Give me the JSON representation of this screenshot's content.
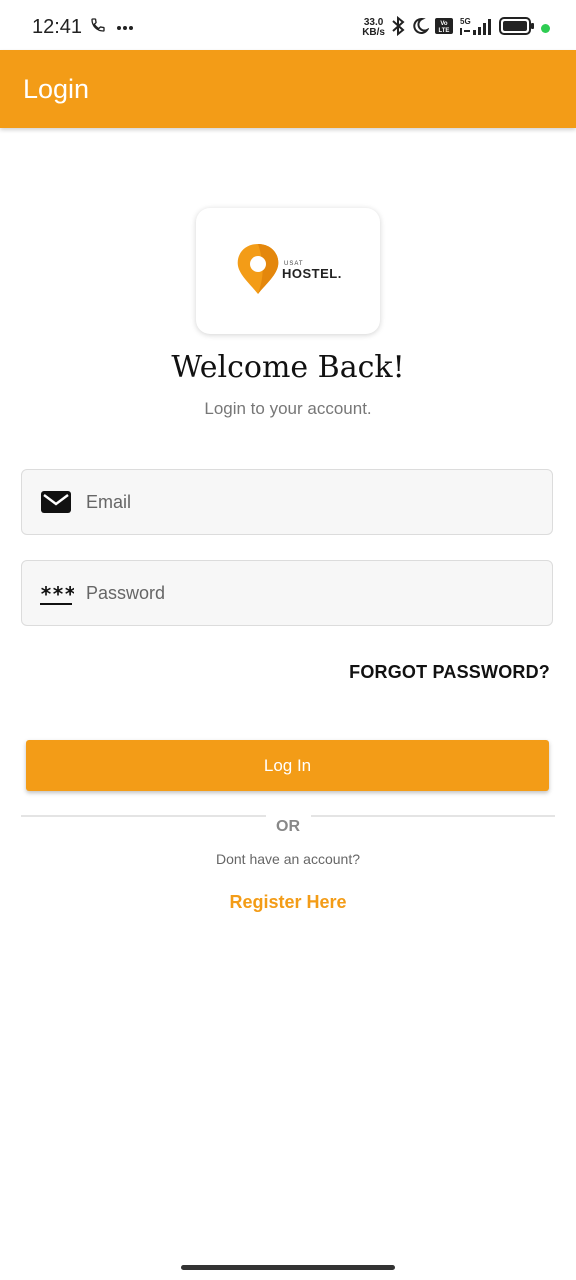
{
  "status_bar": {
    "time": "12:41",
    "net_speed_value": "33.0",
    "net_speed_unit": "KB/s",
    "icons": [
      "phone-icon",
      "more-dots-icon",
      "bluetooth-icon",
      "moon-icon",
      "volte-icon",
      "signal-5g-icon",
      "battery-icon"
    ]
  },
  "app_bar": {
    "title": "Login"
  },
  "logo": {
    "brand_small": "USAT",
    "brand": "HOSTEL."
  },
  "welcome": {
    "title": "Welcome Back!",
    "subtitle": "Login to your account."
  },
  "form": {
    "email": {
      "placeholder": "Email",
      "value": "",
      "icon": "mail-icon"
    },
    "password": {
      "placeholder": "Password",
      "value": "",
      "icon": "password-asterisks-icon",
      "icon_text": "***"
    },
    "forgot_label": "FORGOT PASSWORD?",
    "login_label": "Log In"
  },
  "footer": {
    "or_label": "OR",
    "no_account": "Dont have an account?",
    "register_label": "Register Here"
  },
  "colors": {
    "accent": "#f39c17"
  }
}
